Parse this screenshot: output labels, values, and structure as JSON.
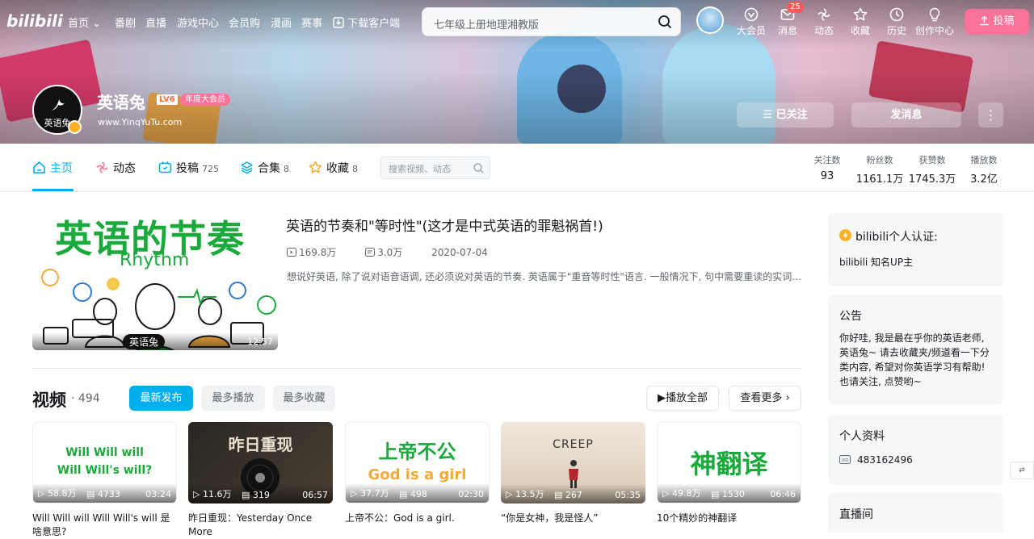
{
  "nav": {
    "logo": "bilibili",
    "links": [
      "首页",
      "番剧",
      "直播",
      "游戏中心",
      "会员购",
      "漫画",
      "赛事",
      "下载客户端"
    ],
    "search_placeholder": "七年级上册地理湘教版",
    "icons": [
      {
        "label": "大会员",
        "icon": "vip-icon"
      },
      {
        "label": "消息",
        "icon": "message-icon"
      },
      {
        "label": "动态",
        "icon": "dynamic-icon"
      },
      {
        "label": "收藏",
        "icon": "star-icon"
      },
      {
        "label": "历史",
        "icon": "clock-icon"
      },
      {
        "label": "创作中心",
        "icon": "bulb-icon"
      }
    ],
    "message_badge": "25",
    "upload": "投稿"
  },
  "profile": {
    "avatar_text": "英语兔",
    "name": "英语兔",
    "level": "LV6",
    "vip": "年度大会员",
    "sign": "www.YinqYuTu.com",
    "follow": "已关注",
    "message": "发消息",
    "more": "⋮"
  },
  "tabs": [
    {
      "label": "主页",
      "count": ""
    },
    {
      "label": "动态",
      "count": ""
    },
    {
      "label": "投稿",
      "count": "725"
    },
    {
      "label": "合集",
      "count": "8"
    },
    {
      "label": "收藏",
      "count": "8"
    }
  ],
  "tab_search_placeholder": "搜索视频、动态",
  "stats": [
    {
      "label": "关注数",
      "value": "93"
    },
    {
      "label": "粉丝数",
      "value": "1161.1万"
    },
    {
      "label": "获赞数",
      "value": "1745.3万"
    },
    {
      "label": "播放数",
      "value": "3.2亿"
    }
  ],
  "featured": {
    "thumb_title": "英语的节奏",
    "thumb_sub": "Rhythm",
    "watermark": "英语兔",
    "duration": "12:57",
    "title": "英语的节奏和\"等时性\"(这才是中式英语的罪魁祸首!)",
    "views": "169.8万",
    "comments": "3.0万",
    "date": "2020-07-04",
    "desc": "想说好英语, 除了说对语音语调, 还必须说对英语的节奏. 英语属于\"重音等时性\"语言. 一般情况下, 句中需要重读的实词之间的时间间隔大致相等"
  },
  "videos_section": {
    "title": "视频",
    "count": "494",
    "filters": [
      "最新发布",
      "最多播放",
      "最多收藏"
    ],
    "play_all": "播放全部",
    "see_more": "查看更多"
  },
  "videos": [
    {
      "thumb": "Will Will will\nWill Will's will?",
      "views": "58.8万",
      "comments": "4733",
      "duration": "03:24",
      "title": "Will Will will Will Will's will 是啥意思?"
    },
    {
      "thumb": "昨日重现",
      "views": "11.6万",
      "comments": "319",
      "duration": "06:57",
      "title": "昨日重现：Yesterday Once More"
    },
    {
      "thumb": "上帝不公",
      "thumb2": "God is a girl",
      "views": "37.7万",
      "comments": "498",
      "duration": "02:30",
      "title": "上帝不公：God is a girl."
    },
    {
      "thumb": "CREEP",
      "views": "13.5万",
      "comments": "267",
      "duration": "05:35",
      "title": "“你是女神，我是怪人”"
    },
    {
      "thumb": "神翻译",
      "views": "49.8万",
      "comments": "1530",
      "duration": "06:46",
      "title": "10个精妙的神翻译"
    }
  ],
  "sidebar": {
    "cert_title": "bilibili个人认证:",
    "cert_text": "bilibili 知名UP主",
    "notice_title": "公告",
    "notice_text": "你好哇, 我是最在乎你的英语老师, 英语兔~ 请去收藏夹/频道看一下分类内容, 希望对你英语学习有帮助! 也请关注, 点赞哟~",
    "info_title": "个人资料",
    "uid": "483162496",
    "live_title": "直播间"
  },
  "colors": {
    "accent": "#00aeec",
    "pink": "#fb7299",
    "green": "#1aaa3b"
  }
}
